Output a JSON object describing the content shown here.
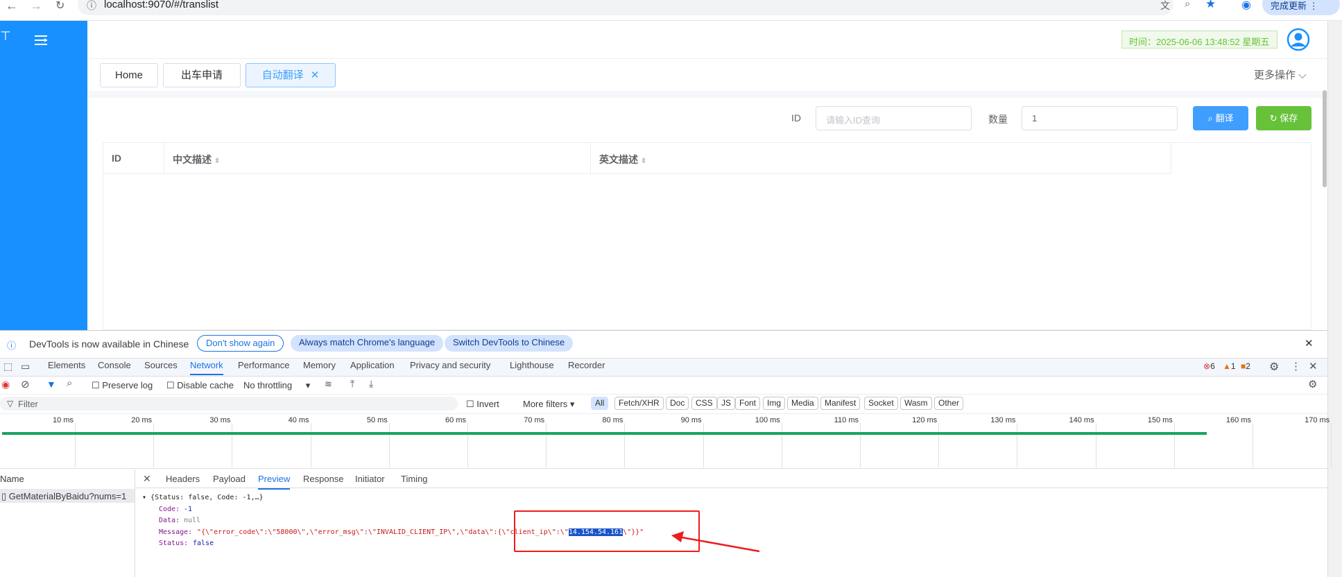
{
  "browser": {
    "url": "localhost:9070/#/translist",
    "update_button": "完成更新"
  },
  "header": {
    "time_badge": "时间：2025-06-06 13:48:52 星期五"
  },
  "tabs": [
    {
      "label": "Home"
    },
    {
      "label": "出车申请"
    },
    {
      "label": "自动翻译"
    }
  ],
  "more_ops": "更多操作",
  "filters": {
    "id_label": "ID",
    "id_placeholder": "请输入ID查询",
    "qty_label": "数量",
    "qty_value": "1",
    "translate_button": "翻译",
    "save_button": "保存"
  },
  "table": {
    "columns": [
      "ID",
      "中文描述",
      "英文描述"
    ]
  },
  "devtools": {
    "info_text": "DevTools is now available in Chinese",
    "dont_show": "Don't show again",
    "always_match": "Always match Chrome's language",
    "switch_chinese": "Switch DevTools to Chinese",
    "tabs": [
      "Elements",
      "Console",
      "Sources",
      "Network",
      "Performance",
      "Memory",
      "Application",
      "Privacy and security",
      "Lighthouse",
      "Recorder"
    ],
    "error_count": "6",
    "warning_count": "1",
    "issue_count": "2",
    "preserve_log": "Preserve log",
    "disable_cache": "Disable cache",
    "throttling": "No throttling",
    "filter_placeholder": "Filter",
    "invert": "Invert",
    "more_filters": "More filters",
    "type_filters": [
      "All",
      "Fetch/XHR",
      "Doc",
      "CSS",
      "JS",
      "Font",
      "Img",
      "Media",
      "Manifest",
      "Socket",
      "Wasm",
      "Other"
    ],
    "timeline_ticks": [
      "10 ms",
      "20 ms",
      "30 ms",
      "40 ms",
      "50 ms",
      "60 ms",
      "70 ms",
      "80 ms",
      "90 ms",
      "100 ms",
      "110 ms",
      "120 ms",
      "130 ms",
      "140 ms",
      "150 ms",
      "160 ms",
      "170 ms"
    ],
    "name_header": "Name",
    "request_name": "GetMaterialByBaidu?nums=1",
    "panel_tabs": [
      "Headers",
      "Payload",
      "Preview",
      "Response",
      "Initiator",
      "Timing"
    ],
    "preview": {
      "summary": "{Status: false, Code: -1,…}",
      "code_key": "Code:",
      "code_val": "-1",
      "data_key": "Data:",
      "data_val": "null",
      "message_key": "Message:",
      "message_val_pre": "\"{\\\"error_code\\\":\\\"58000\\\",\\\"error_msg\\\":\\\"INVALID_CLIENT_IP\\\",\\\"data\\\":{\\\"client_ip\\\":\\\"",
      "message_ip": "14.154.54.161",
      "message_val_post": "\\\"}}\"",
      "status_key": "Status:",
      "status_val": "false"
    }
  }
}
